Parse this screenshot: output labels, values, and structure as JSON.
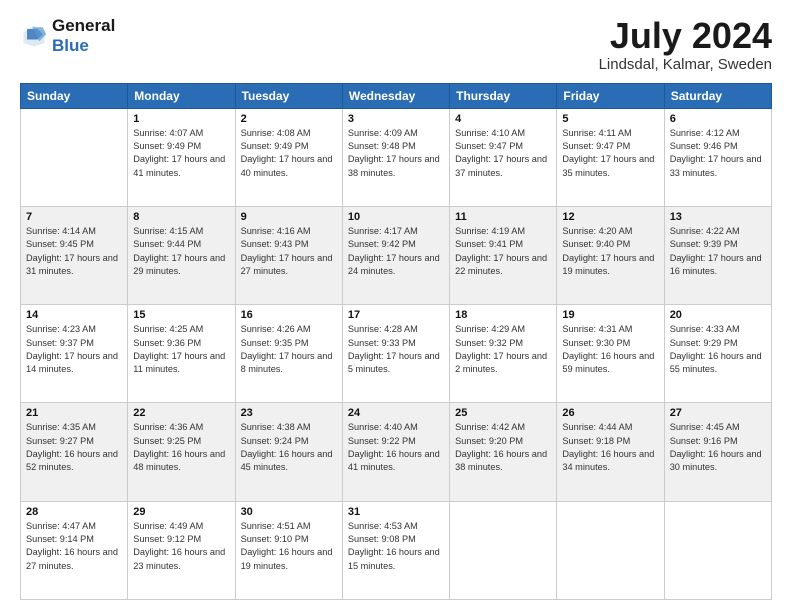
{
  "logo": {
    "line1": "General",
    "line2": "Blue"
  },
  "title": "July 2024",
  "location": "Lindsdal, Kalmar, Sweden",
  "days_header": [
    "Sunday",
    "Monday",
    "Tuesday",
    "Wednesday",
    "Thursday",
    "Friday",
    "Saturday"
  ],
  "weeks": [
    [
      {
        "day": "",
        "sunrise": "",
        "sunset": "",
        "daylight": ""
      },
      {
        "day": "1",
        "sunrise": "Sunrise: 4:07 AM",
        "sunset": "Sunset: 9:49 PM",
        "daylight": "Daylight: 17 hours and 41 minutes."
      },
      {
        "day": "2",
        "sunrise": "Sunrise: 4:08 AM",
        "sunset": "Sunset: 9:49 PM",
        "daylight": "Daylight: 17 hours and 40 minutes."
      },
      {
        "day": "3",
        "sunrise": "Sunrise: 4:09 AM",
        "sunset": "Sunset: 9:48 PM",
        "daylight": "Daylight: 17 hours and 38 minutes."
      },
      {
        "day": "4",
        "sunrise": "Sunrise: 4:10 AM",
        "sunset": "Sunset: 9:47 PM",
        "daylight": "Daylight: 17 hours and 37 minutes."
      },
      {
        "day": "5",
        "sunrise": "Sunrise: 4:11 AM",
        "sunset": "Sunset: 9:47 PM",
        "daylight": "Daylight: 17 hours and 35 minutes."
      },
      {
        "day": "6",
        "sunrise": "Sunrise: 4:12 AM",
        "sunset": "Sunset: 9:46 PM",
        "daylight": "Daylight: 17 hours and 33 minutes."
      }
    ],
    [
      {
        "day": "7",
        "sunrise": "Sunrise: 4:14 AM",
        "sunset": "Sunset: 9:45 PM",
        "daylight": "Daylight: 17 hours and 31 minutes."
      },
      {
        "day": "8",
        "sunrise": "Sunrise: 4:15 AM",
        "sunset": "Sunset: 9:44 PM",
        "daylight": "Daylight: 17 hours and 29 minutes."
      },
      {
        "day": "9",
        "sunrise": "Sunrise: 4:16 AM",
        "sunset": "Sunset: 9:43 PM",
        "daylight": "Daylight: 17 hours and 27 minutes."
      },
      {
        "day": "10",
        "sunrise": "Sunrise: 4:17 AM",
        "sunset": "Sunset: 9:42 PM",
        "daylight": "Daylight: 17 hours and 24 minutes."
      },
      {
        "day": "11",
        "sunrise": "Sunrise: 4:19 AM",
        "sunset": "Sunset: 9:41 PM",
        "daylight": "Daylight: 17 hours and 22 minutes."
      },
      {
        "day": "12",
        "sunrise": "Sunrise: 4:20 AM",
        "sunset": "Sunset: 9:40 PM",
        "daylight": "Daylight: 17 hours and 19 minutes."
      },
      {
        "day": "13",
        "sunrise": "Sunrise: 4:22 AM",
        "sunset": "Sunset: 9:39 PM",
        "daylight": "Daylight: 17 hours and 16 minutes."
      }
    ],
    [
      {
        "day": "14",
        "sunrise": "Sunrise: 4:23 AM",
        "sunset": "Sunset: 9:37 PM",
        "daylight": "Daylight: 17 hours and 14 minutes."
      },
      {
        "day": "15",
        "sunrise": "Sunrise: 4:25 AM",
        "sunset": "Sunset: 9:36 PM",
        "daylight": "Daylight: 17 hours and 11 minutes."
      },
      {
        "day": "16",
        "sunrise": "Sunrise: 4:26 AM",
        "sunset": "Sunset: 9:35 PM",
        "daylight": "Daylight: 17 hours and 8 minutes."
      },
      {
        "day": "17",
        "sunrise": "Sunrise: 4:28 AM",
        "sunset": "Sunset: 9:33 PM",
        "daylight": "Daylight: 17 hours and 5 minutes."
      },
      {
        "day": "18",
        "sunrise": "Sunrise: 4:29 AM",
        "sunset": "Sunset: 9:32 PM",
        "daylight": "Daylight: 17 hours and 2 minutes."
      },
      {
        "day": "19",
        "sunrise": "Sunrise: 4:31 AM",
        "sunset": "Sunset: 9:30 PM",
        "daylight": "Daylight: 16 hours and 59 minutes."
      },
      {
        "day": "20",
        "sunrise": "Sunrise: 4:33 AM",
        "sunset": "Sunset: 9:29 PM",
        "daylight": "Daylight: 16 hours and 55 minutes."
      }
    ],
    [
      {
        "day": "21",
        "sunrise": "Sunrise: 4:35 AM",
        "sunset": "Sunset: 9:27 PM",
        "daylight": "Daylight: 16 hours and 52 minutes."
      },
      {
        "day": "22",
        "sunrise": "Sunrise: 4:36 AM",
        "sunset": "Sunset: 9:25 PM",
        "daylight": "Daylight: 16 hours and 48 minutes."
      },
      {
        "day": "23",
        "sunrise": "Sunrise: 4:38 AM",
        "sunset": "Sunset: 9:24 PM",
        "daylight": "Daylight: 16 hours and 45 minutes."
      },
      {
        "day": "24",
        "sunrise": "Sunrise: 4:40 AM",
        "sunset": "Sunset: 9:22 PM",
        "daylight": "Daylight: 16 hours and 41 minutes."
      },
      {
        "day": "25",
        "sunrise": "Sunrise: 4:42 AM",
        "sunset": "Sunset: 9:20 PM",
        "daylight": "Daylight: 16 hours and 38 minutes."
      },
      {
        "day": "26",
        "sunrise": "Sunrise: 4:44 AM",
        "sunset": "Sunset: 9:18 PM",
        "daylight": "Daylight: 16 hours and 34 minutes."
      },
      {
        "day": "27",
        "sunrise": "Sunrise: 4:45 AM",
        "sunset": "Sunset: 9:16 PM",
        "daylight": "Daylight: 16 hours and 30 minutes."
      }
    ],
    [
      {
        "day": "28",
        "sunrise": "Sunrise: 4:47 AM",
        "sunset": "Sunset: 9:14 PM",
        "daylight": "Daylight: 16 hours and 27 minutes."
      },
      {
        "day": "29",
        "sunrise": "Sunrise: 4:49 AM",
        "sunset": "Sunset: 9:12 PM",
        "daylight": "Daylight: 16 hours and 23 minutes."
      },
      {
        "day": "30",
        "sunrise": "Sunrise: 4:51 AM",
        "sunset": "Sunset: 9:10 PM",
        "daylight": "Daylight: 16 hours and 19 minutes."
      },
      {
        "day": "31",
        "sunrise": "Sunrise: 4:53 AM",
        "sunset": "Sunset: 9:08 PM",
        "daylight": "Daylight: 16 hours and 15 minutes."
      },
      {
        "day": "",
        "sunrise": "",
        "sunset": "",
        "daylight": ""
      },
      {
        "day": "",
        "sunrise": "",
        "sunset": "",
        "daylight": ""
      },
      {
        "day": "",
        "sunrise": "",
        "sunset": "",
        "daylight": ""
      }
    ]
  ]
}
